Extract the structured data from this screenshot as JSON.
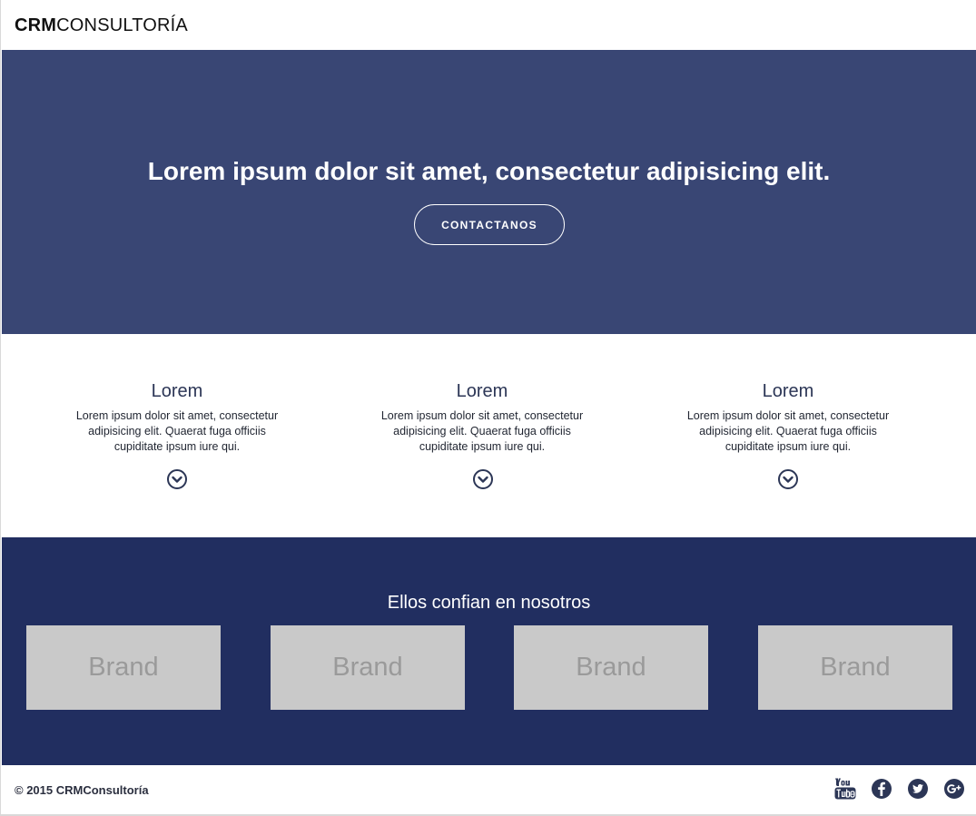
{
  "header": {
    "logo_bold": "CRM",
    "logo_rest": "CONSULTORÍA"
  },
  "hero": {
    "title": "Lorem ipsum dolor sit amet, consectetur adipisicing elit.",
    "button_label": "CONTACTANOS",
    "background_color": "#394674"
  },
  "features": [
    {
      "title": "Lorem",
      "text_line1": "Lorem ipsum dolor sit amet, consectetur",
      "text_line2": "adipisicing elit. Quaerat fuga officiis",
      "text_line3": "cupiditate ipsum iure qui.",
      "icon": "chevron-down-circle-icon"
    },
    {
      "title": "Lorem",
      "text_line1": "Lorem ipsum dolor sit amet, consectetur",
      "text_line2": "adipisicing elit. Quaerat fuga officiis",
      "text_line3": "cupiditate ipsum iure qui.",
      "icon": "chevron-down-circle-icon"
    },
    {
      "title": "Lorem",
      "text_line1": "Lorem ipsum dolor sit amet, consectetur",
      "text_line2": "adipisicing elit. Quaerat fuga officiis",
      "text_line3": "cupiditate ipsum iure qui.",
      "icon": "chevron-down-circle-icon"
    }
  ],
  "trust": {
    "title": "Ellos confian en nosotros",
    "background_color": "#212e60",
    "brands": [
      "Brand",
      "Brand",
      "Brand",
      "Brand"
    ]
  },
  "footer": {
    "copyright": "© 2015 CRMConsultoría",
    "social": [
      "youtube-icon",
      "facebook-icon",
      "twitter-icon",
      "google-plus-icon"
    ]
  }
}
